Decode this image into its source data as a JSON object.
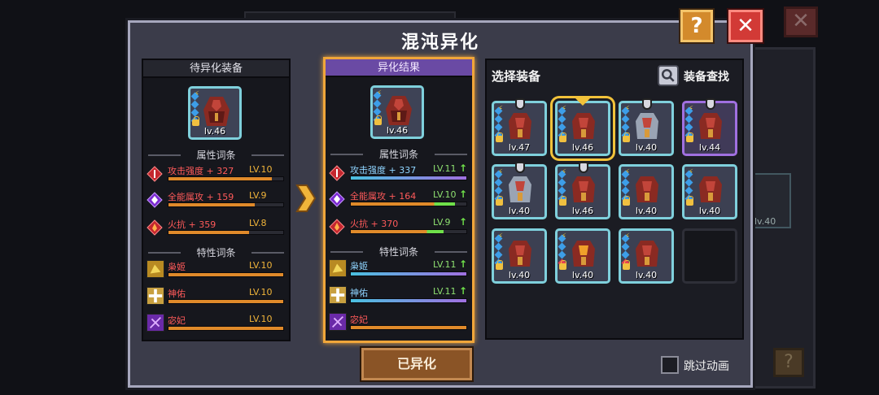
{
  "dialog": {
    "title": "混沌异化",
    "help_label": "?",
    "close_label": "✕",
    "done_button": "已异化",
    "skip_animation": "跳过动画"
  },
  "colors": {
    "accent_orange": "#f0a63a",
    "stat_red": "#ff5a5a",
    "level_up_green": "#6fe04a",
    "item_border_cyan": "#7fd0dc"
  },
  "pending": {
    "header": "待异化装备",
    "item_level": "lv.46",
    "attr_section": "属性词条",
    "trait_section": "特性词条",
    "stats": [
      {
        "name": "攻击强度 + 327",
        "level": "LV.10",
        "fill": 0.9
      },
      {
        "name": "全能属攻 + 159",
        "level": "LV.9",
        "fill": 0.75
      },
      {
        "name": "火抗 + 359",
        "level": "LV.8",
        "fill": 0.7
      }
    ],
    "traits": [
      {
        "name": "枭姬",
        "level": "LV.10",
        "fill": 1.0
      },
      {
        "name": "神佑",
        "level": "LV.10",
        "fill": 1.0
      },
      {
        "name": "宓妃",
        "level": "LV.10",
        "fill": 1.0
      }
    ]
  },
  "result": {
    "header": "异化结果",
    "item_level": "lv.46",
    "attr_section": "属性词条",
    "trait_section": "特性词条",
    "stats": [
      {
        "name": "攻击强度 + 337",
        "level": "LV.11",
        "fill": 1.0,
        "up": "↑"
      },
      {
        "name": "全能属攻 + 164",
        "level": "LV.10",
        "fill": 0.9,
        "up": "↑"
      },
      {
        "name": "火抗 + 370",
        "level": "LV.9",
        "fill": 0.8,
        "up": "↑"
      }
    ],
    "traits": [
      {
        "name": "枭姬",
        "level": "LV.11",
        "fill": 1.0,
        "up": "↑"
      },
      {
        "name": "神佑",
        "level": "LV.11",
        "fill": 1.0,
        "up": "↑"
      },
      {
        "name": "宓妃",
        "level": "",
        "fill": 1.0,
        "up": ""
      }
    ]
  },
  "selector": {
    "title": "选择装备",
    "find_label": "装备查找",
    "items": [
      {
        "level": "lv.47",
        "pinned": true,
        "selected": false,
        "style": "cyan"
      },
      {
        "level": "lv.46",
        "pinned": false,
        "selected": true,
        "style": "cyan"
      },
      {
        "level": "lv.40",
        "pinned": true,
        "selected": false,
        "style": "cyan"
      },
      {
        "level": "lv.44",
        "pinned": true,
        "selected": false,
        "style": "purple"
      },
      {
        "level": "lv.40",
        "pinned": true,
        "selected": false,
        "style": "cyan"
      },
      {
        "level": "lv.46",
        "pinned": true,
        "selected": false,
        "style": "cyan"
      },
      {
        "level": "lv.40",
        "pinned": false,
        "selected": false,
        "style": "cyan"
      },
      {
        "level": "lv.40",
        "pinned": false,
        "selected": false,
        "style": "cyan"
      },
      {
        "level": "lv.40",
        "pinned": false,
        "selected": false,
        "style": "cyan"
      },
      {
        "level": "lv.40",
        "pinned": false,
        "selected": false,
        "style": "cyan"
      },
      {
        "level": "lv.40",
        "pinned": false,
        "selected": false,
        "style": "cyan"
      },
      {
        "level": "",
        "pinned": false,
        "selected": false,
        "style": "empty"
      }
    ]
  },
  "background": {
    "side_item_level": "lv.40"
  }
}
